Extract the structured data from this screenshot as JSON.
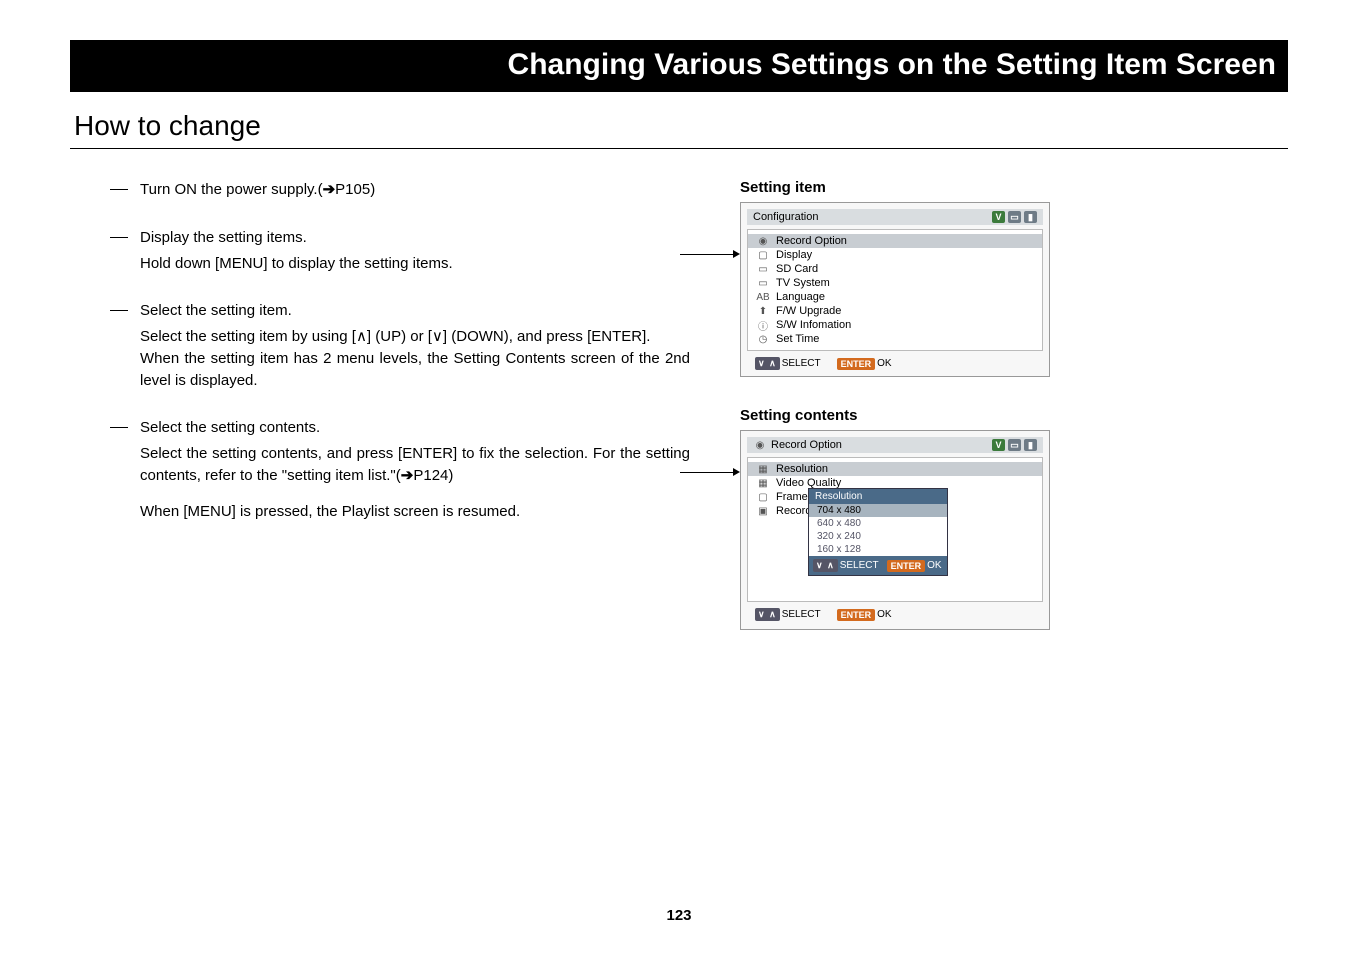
{
  "banner": "Changing Various Settings on the Setting Item Screen",
  "heading": "How to change",
  "steps": {
    "s1": {
      "head_pre": "Turn ON the power supply.(",
      "head_link": "P105",
      "head_post": ")"
    },
    "s2": {
      "head": "Display the setting items.",
      "body": "Hold down [MENU] to display the setting items."
    },
    "s3": {
      "head": "Select the setting item.",
      "body1": "Select the setting item by using [∧] (UP) or [∨] (DOWN), and press [ENTER].",
      "body2": "When the setting item has 2 menu levels, the Setting Contents screen of the 2nd level is displayed."
    },
    "s4": {
      "head": "Select the setting contents.",
      "body1_pre": "Select the setting contents, and press [ENTER] to fix the selection. For the setting contents, refer to the \"setting item list.\"(",
      "body1_link": "P124",
      "body1_post": ")",
      "body2": "When [MENU] is pressed, the Playlist screen is resumed."
    }
  },
  "panel1": {
    "label": "Setting item",
    "title": "Configuration",
    "items": [
      {
        "icon": "◉",
        "label": "Record Option",
        "selected": true
      },
      {
        "icon": "▢",
        "label": "Display"
      },
      {
        "icon": "▭",
        "label": "SD Card"
      },
      {
        "icon": "▭",
        "label": "TV System"
      },
      {
        "icon": "AB",
        "label": "Language"
      },
      {
        "icon": "⬆",
        "label": "F/W Upgrade"
      },
      {
        "icon": "ⓘ",
        "label": "S/W Infomation"
      },
      {
        "icon": "◷",
        "label": "Set Time"
      }
    ],
    "footer": {
      "nav_keys": "∨ ∧",
      "nav_label": "SELECT",
      "enter_key": "ENTER",
      "enter_label": "OK"
    }
  },
  "panel2": {
    "label": "Setting contents",
    "title": "Record Option",
    "items": [
      {
        "icon": "▦",
        "label": "Resolution",
        "selected": true
      },
      {
        "icon": "▦",
        "label": "Video Quality"
      },
      {
        "icon": "▢",
        "label": "Frame"
      },
      {
        "icon": "▣",
        "label": "Record"
      }
    ],
    "popup": {
      "title": "Resolution",
      "options": [
        {
          "label": "704 x 480",
          "selected": true
        },
        {
          "label": "640 x 480"
        },
        {
          "label": "320 x 240"
        },
        {
          "label": "160 x 128"
        }
      ],
      "footer": {
        "nav_keys": "∨ ∧",
        "nav_label": "SELECT",
        "enter_key": "ENTER",
        "enter_label": "OK"
      }
    },
    "footer": {
      "nav_keys": "∨ ∧",
      "nav_label": "SELECT",
      "enter_key": "ENTER",
      "enter_label": "OK"
    }
  },
  "status": {
    "v": "V",
    "sd": "▭",
    "batt": "▮"
  },
  "arrow_glyph": "➔",
  "page_number": "123"
}
